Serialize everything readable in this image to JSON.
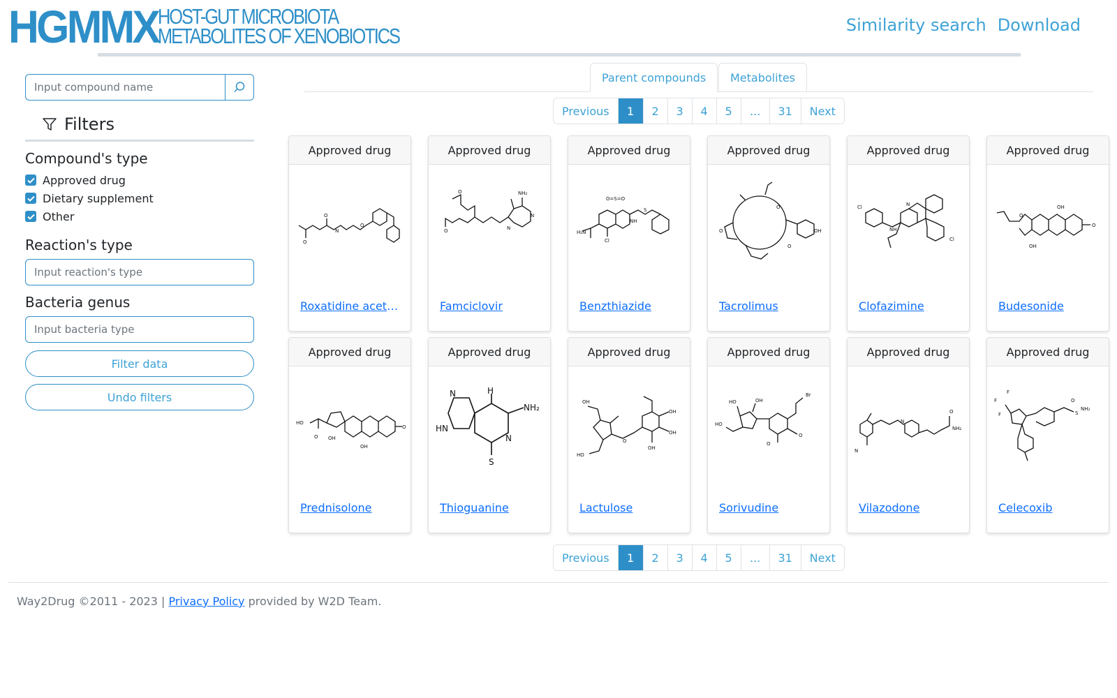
{
  "header": {
    "logo_short": "HGMMX",
    "logo_line1": "HOST-GUT MICROBIOTA",
    "logo_line2": "METABOLITES OF XENOBIOTICS",
    "nav": [
      "Similarity search",
      "Download"
    ],
    "brand_color": "#2e8fc8"
  },
  "sidebar": {
    "search_placeholder": "Input compound name",
    "filters_title": "Filters",
    "compound_type_title": "Compound's type",
    "compound_types": [
      {
        "label": "Approved drug",
        "checked": true
      },
      {
        "label": "Dietary supplement",
        "checked": true
      },
      {
        "label": "Other",
        "checked": true
      }
    ],
    "reaction_type_title": "Reaction's type",
    "reaction_placeholder": "Input reaction's type",
    "bacteria_title": "Bacteria genus",
    "bacteria_placeholder": "Input bacteria type",
    "filter_button": "Filter data",
    "undo_button": "Undo filters"
  },
  "tabs": [
    {
      "label": "Parent compounds",
      "active": true
    },
    {
      "label": "Metabolites",
      "active": false
    }
  ],
  "pagination": {
    "items": [
      "Previous",
      "1",
      "2",
      "3",
      "4",
      "5",
      "...",
      "31",
      "Next"
    ],
    "active": "1"
  },
  "cards": [
    {
      "type": "Approved drug",
      "name": "Roxatidine acetate"
    },
    {
      "type": "Approved drug",
      "name": "Famciclovir"
    },
    {
      "type": "Approved drug",
      "name": "Benzthiazide"
    },
    {
      "type": "Approved drug",
      "name": "Tacrolimus"
    },
    {
      "type": "Approved drug",
      "name": "Clofazimine"
    },
    {
      "type": "Approved drug",
      "name": "Budesonide"
    },
    {
      "type": "Approved drug",
      "name": "Prednisolone"
    },
    {
      "type": "Approved drug",
      "name": "Thioguanine"
    },
    {
      "type": "Approved drug",
      "name": "Lactulose"
    },
    {
      "type": "Approved drug",
      "name": "Sorivudine"
    },
    {
      "type": "Approved drug",
      "name": "Vilazodone"
    },
    {
      "type": "Approved drug",
      "name": "Celecoxib"
    }
  ],
  "footer": {
    "copyright": "Way2Drug ©2011 - 2023 |",
    "privacy": "Privacy Policy",
    "provided": "provided by W2D Team."
  }
}
